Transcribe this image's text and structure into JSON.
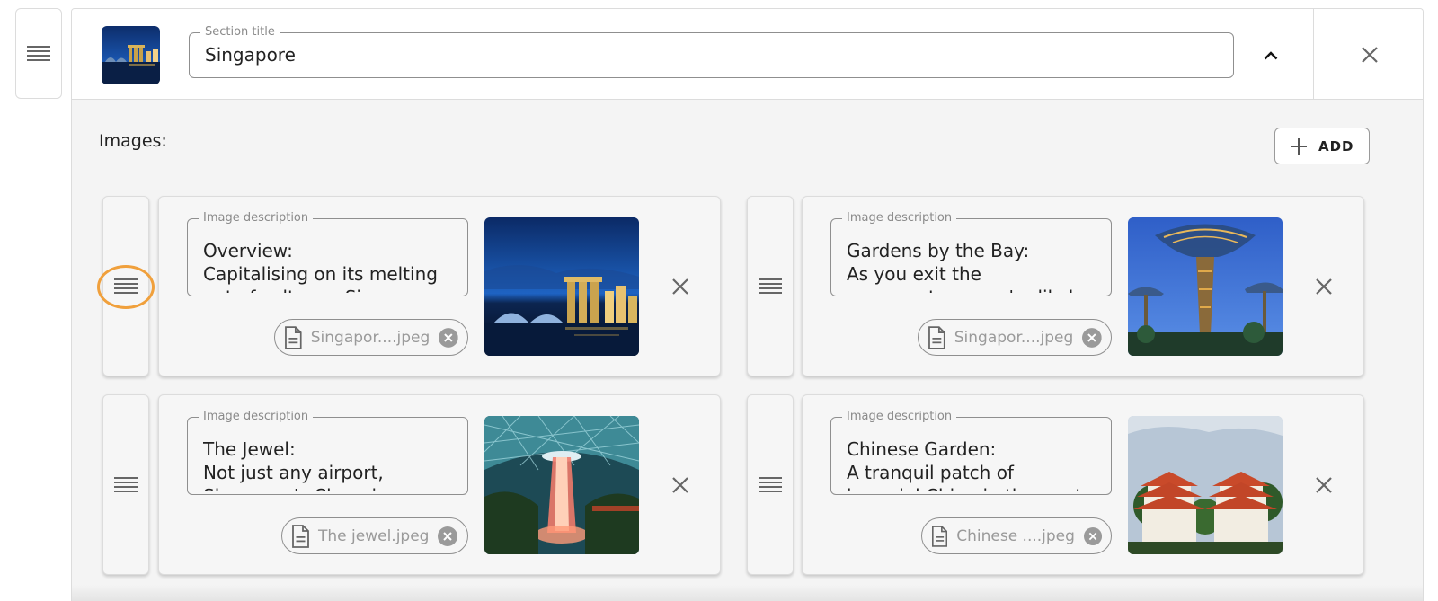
{
  "section": {
    "title_legend": "Section title",
    "title_value": "Singapore",
    "thumbnail": "singapore-skyline-night-thumb",
    "icons": {
      "drag": "drag-handle-icon",
      "collapse": "chevron-up-icon",
      "close": "close-icon"
    }
  },
  "images": {
    "label": "Images:",
    "add_label": "ADD",
    "add_icon": "plus-icon",
    "items": [
      {
        "description_legend": "Image description",
        "description": "Overview:\nCapitalising on its melting\npot of cultures, Singapore",
        "file_name": "Singapor....jpeg",
        "image": "marina-bay-skyline-night"
      },
      {
        "description_legend": "Image description",
        "description": "Gardens by the Bay:\nAs you exit the\nconservatory, you're likely",
        "file_name": "Singapor....jpeg",
        "image": "supertree-grove"
      },
      {
        "description_legend": "Image description",
        "description": "The Jewel:\nNot just any airport,\nSingapore's Changi",
        "file_name": "The jewel.jpeg",
        "image": "jewel-changi-rain-vortex"
      },
      {
        "description_legend": "Image description",
        "description": "Chinese Garden:\nA tranquil patch of\nimperial China in the west",
        "file_name": "Chinese ....jpeg",
        "image": "chinese-garden-pagodas"
      }
    ]
  },
  "colors": {
    "panel_bg": "#f4f4f4",
    "border": "#dcdcdc",
    "highlight": "#f0a03c"
  }
}
